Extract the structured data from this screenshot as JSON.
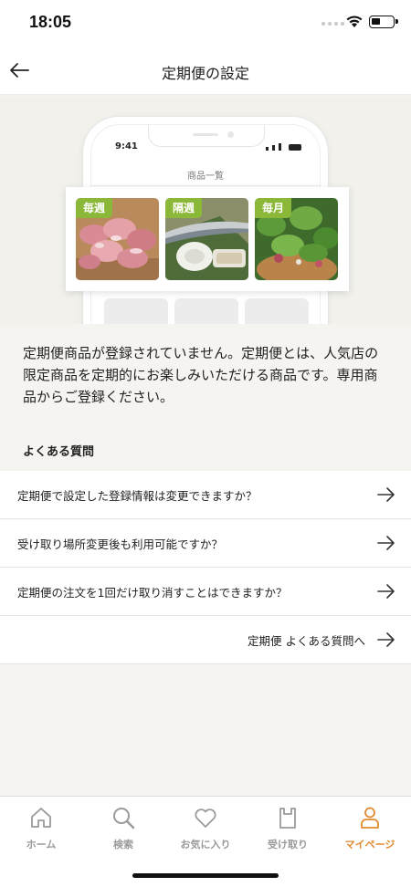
{
  "status_bar": {
    "time": "18:05"
  },
  "nav": {
    "title": "定期便の設定",
    "back_icon": "arrow-left-icon"
  },
  "hero": {
    "phone_time": "9:41",
    "phone_screen_title": "商品一覧",
    "products": [
      {
        "tag": "毎週",
        "image": "meat-image"
      },
      {
        "tag": "隔週",
        "image": "fish-image"
      },
      {
        "tag": "毎月",
        "image": "vegetables-image"
      }
    ]
  },
  "description": "定期便商品が登録されていません。定期便とは、人気店の限定商品を定期的にお楽しみいただける商品です。専用商品からご登録ください。",
  "faq": {
    "heading": "よくある質問",
    "items": [
      {
        "text": "定期便で設定した登録情報は変更できますか？"
      },
      {
        "text": "受け取り場所変更後も利用可能ですか？"
      },
      {
        "text": "定期便の注文を1回だけ取り消すことはできますか？"
      }
    ],
    "more_link": "定期便 よくある質問へ"
  },
  "tab_bar": {
    "active_color": "#e08a2e",
    "inactive_color": "#9a9a9a",
    "tabs": [
      {
        "label": "ホーム",
        "icon": "home-icon"
      },
      {
        "label": "検索",
        "icon": "search-icon"
      },
      {
        "label": "お気に入り",
        "icon": "heart-icon"
      },
      {
        "label": "受け取り",
        "icon": "bag-icon"
      },
      {
        "label": "マイページ",
        "icon": "person-icon",
        "active": true
      }
    ]
  }
}
